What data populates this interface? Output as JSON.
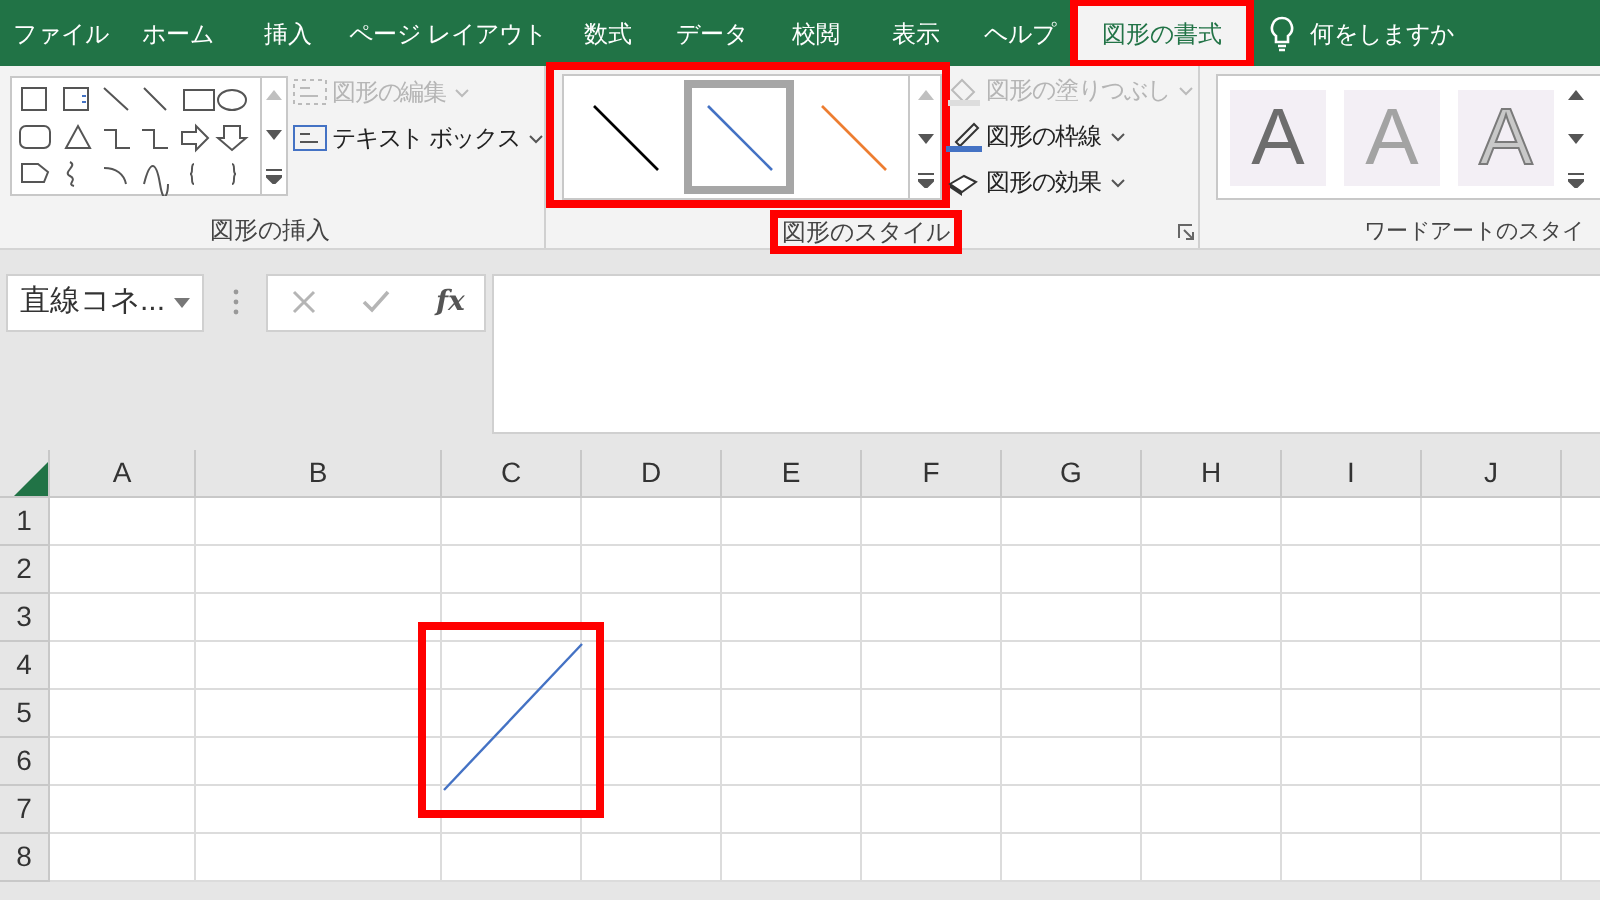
{
  "tabs": [
    {
      "label": "ファイル",
      "selected": false,
      "highlighted": false
    },
    {
      "label": "ホーム",
      "selected": false,
      "highlighted": false
    },
    {
      "label": "挿入",
      "selected": false,
      "highlighted": false
    },
    {
      "label": "ページ レイアウト",
      "selected": false,
      "highlighted": false
    },
    {
      "label": "数式",
      "selected": false,
      "highlighted": false
    },
    {
      "label": "データ",
      "selected": false,
      "highlighted": false
    },
    {
      "label": "校閲",
      "selected": false,
      "highlighted": false
    },
    {
      "label": "表示",
      "selected": false,
      "highlighted": false
    },
    {
      "label": "ヘルプ",
      "selected": false,
      "highlighted": false
    },
    {
      "label": "図形の書式",
      "selected": true,
      "highlighted": true
    }
  ],
  "tell_me": {
    "placeholder": "何をしますか"
  },
  "insert_shapes": {
    "label": "図形の挿入",
    "buttons": [
      {
        "label": "図形の編集",
        "disabled": true
      },
      {
        "label": "テキスト ボックス",
        "disabled": false
      }
    ]
  },
  "shape_styles": {
    "label": "図形のスタイル",
    "highlighted": true,
    "styles": [
      {
        "color": "#000000",
        "selected": false
      },
      {
        "color": "#4472c4",
        "selected": true
      },
      {
        "color": "#ed7d31",
        "selected": false
      }
    ],
    "buttons": [
      {
        "label": "図形の塗りつぶし",
        "disabled": true
      },
      {
        "label": "図形の枠線",
        "disabled": false
      },
      {
        "label": "図形の効果",
        "disabled": false
      }
    ]
  },
  "wordart_styles": {
    "label": "ワードアートのスタイ",
    "samples": [
      {
        "text": "A"
      },
      {
        "text": "A"
      },
      {
        "text": "A"
      }
    ]
  },
  "name_box": {
    "value": "直線コネ..."
  },
  "function_button": "fx",
  "columns": [
    "A",
    "B",
    "C",
    "D",
    "E",
    "F",
    "G",
    "H",
    "I",
    "J"
  ],
  "rows": [
    "1",
    "2",
    "3",
    "4",
    "5",
    "6",
    "7",
    "8"
  ],
  "shape": {
    "highlighted": true
  }
}
